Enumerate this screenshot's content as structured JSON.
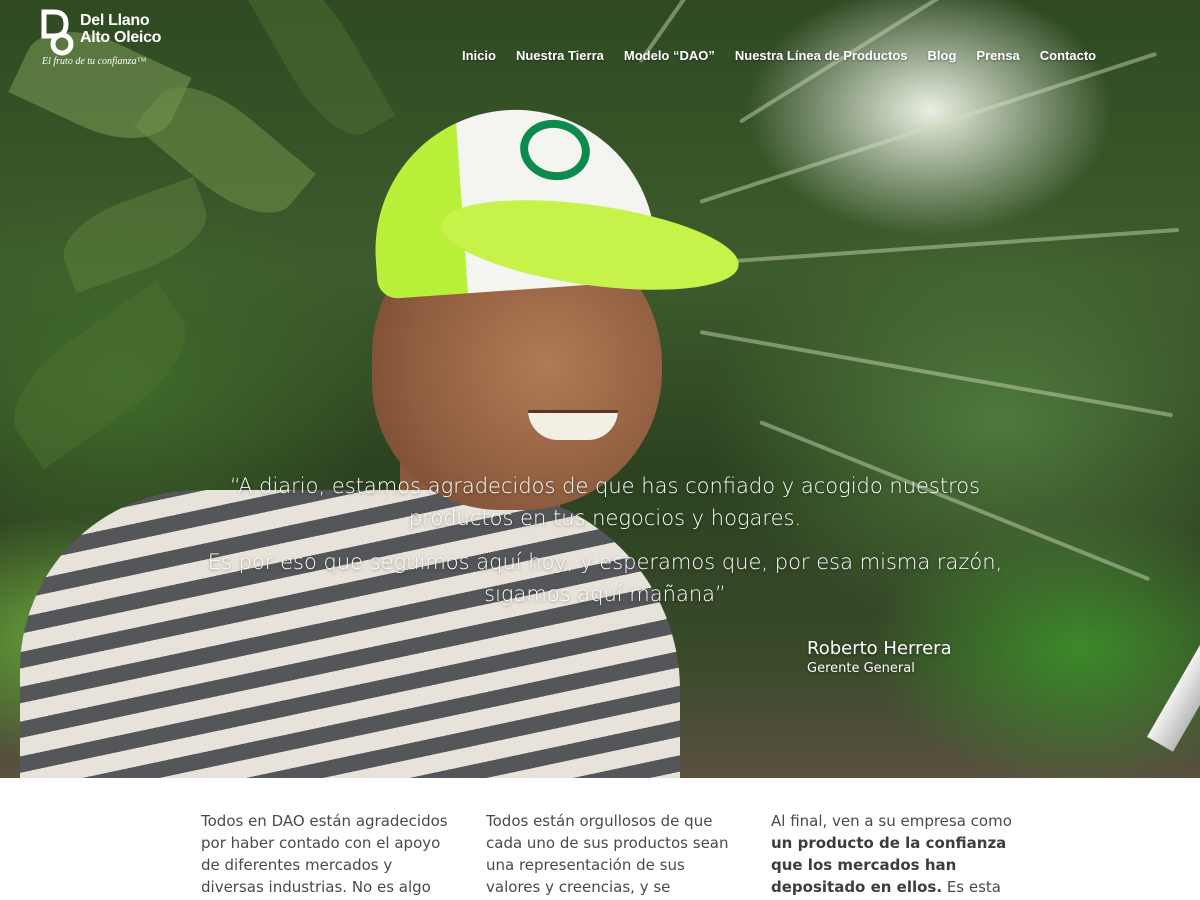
{
  "brand": {
    "name_line1": "Del Llano",
    "name_line2": "Alto Oleico",
    "tagline": "El fruto de tu confianza™"
  },
  "nav": {
    "items": [
      "Inicio",
      "Nuestra Tierra",
      "Modelo “DAO”",
      "Nuestra Línea de Productos",
      "Blog",
      "Prensa",
      "Contacto"
    ]
  },
  "quote": {
    "paragraph1": "“A diario, estamos agradecidos de que has confiado y acogido nuestros productos en tus negocios y hogares.",
    "paragraph2": "Es por eso que seguimos aquí hoy, y esperamos que, por esa misma razón, sigamos aquí mañana”",
    "author_name": "Roberto Herrera",
    "author_role": "Gerente General"
  },
  "columns": {
    "col1": "Todos en DAO están agradecidos por haber contado con el apoyo de diferentes mercados y diversas industrias. No es algo que tomen a",
    "col2": "Todos están orgullosos de que cada uno de sus productos sean una representación de sus valores y creencias, y se aseguran a diario",
    "col3_intro": "Al final, ven a su empresa como ",
    "col3_bold": "un producto de la confianza que los mercados han depositado en ellos.",
    "col3_outro": " Es esta confianza la que"
  },
  "colors": {
    "brand_green": "#0d8a4e",
    "cap_green": "#b8f03a",
    "text_gray": "#4a4a4a"
  },
  "icons": {
    "logo": "dao-logo-icon"
  }
}
